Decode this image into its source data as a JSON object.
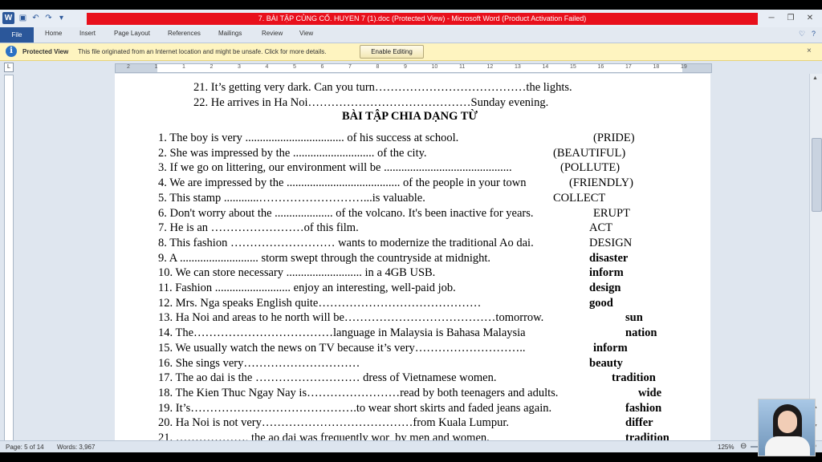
{
  "window": {
    "title": "7. BÀI TẬP CỦNG CỐ. HUYEN 7 (1).doc (Protected View)  -  Microsoft Word (Product Activation Failed)",
    "app_letter": "W"
  },
  "ribbon": {
    "tabs": [
      "File",
      "Home",
      "Insert",
      "Page Layout",
      "References",
      "Mailings",
      "Review",
      "View"
    ]
  },
  "protected_view": {
    "title": "Protected View",
    "message": "This file originated from an Internet location and might be unsafe. Click for more details.",
    "button": "Enable Editing",
    "close": "×"
  },
  "ruler": {
    "numbers": [
      "2",
      "1",
      "1",
      "2",
      "3",
      "4",
      "5",
      "6",
      "7",
      "8",
      "9",
      "10",
      "11",
      "12",
      "13",
      "14",
      "15",
      "16",
      "17",
      "18",
      "19"
    ]
  },
  "document": {
    "top_lines": [
      {
        "text": "21. It’s getting very dark. Can you turn…………………………………the lights."
      },
      {
        "text": "22. He arrives in Ha Noi……………………………………Sunday evening."
      }
    ],
    "heading": "BÀI TẬP CHIA DẠNG TỪ",
    "exercises": [
      {
        "sentence": "1. The boy is very .................................. of his success at school.",
        "word": "(PRIDE)",
        "bold": false
      },
      {
        "sentence": "2. She was impressed by the ............................ of the city.",
        "word": "(BEAUTIFUL)",
        "bold": false
      },
      {
        "sentence": "3. If we go on littering, our environment will be ............................................",
        "word": "(POLLUTE)",
        "bold": false
      },
      {
        "sentence": "4. We are impressed by the ....................................... of the people in your town",
        "word": "(FRIENDLY)",
        "bold": false
      },
      {
        "sentence": "5. This stamp ............………………………...is valuable.",
        "word": "COLLECT",
        "bold": false
      },
      {
        "sentence": "6. Don't worry about the .................... of the volcano. It's been inactive for years.",
        "word": "ERUPT",
        "bold": false
      },
      {
        "sentence": "7. He is an ……………………of this film.",
        "word": "ACT",
        "bold": false
      },
      {
        "sentence": "8. This fashion ……………………… wants to modernize the traditional Ao dai.",
        "word": "DESIGN",
        "bold": false
      },
      {
        "sentence": "9. A ........................... storm swept through the countryside at midnight.",
        "word": "disaster",
        "bold": true
      },
      {
        "sentence": "10. We can store necessary .......................... in a 4GB USB.",
        "word": "inform",
        "bold": true
      },
      {
        "sentence": "11. Fashion .......................... enjoy an interesting, well-paid job.",
        "word": "design",
        "bold": true
      },
      {
        "sentence": "12. Mrs. Nga speaks English quite……………………………………",
        "word": "good",
        "bold": true
      },
      {
        "sentence": "13. Ha Noi and areas to he north will be…………………………………tomorrow.",
        "word": "sun",
        "bold": true
      },
      {
        "sentence": "14. The………………………………language in Malaysia is Bahasa Malaysia",
        "word": "nation",
        "bold": true
      },
      {
        "sentence": "15. We usually watch the news on TV because it’s very………………………..",
        "word": "inform",
        "bold": true
      },
      {
        "sentence": "16. She sings very…………………………",
        "word": "beauty",
        "bold": true
      },
      {
        "sentence": "17. The ao dai is the ……………………… dress of Vietnamese women.",
        "word": "tradition",
        "bold": true
      },
      {
        "sentence": "18. The Kien Thuc Ngay Nay is……………………read by both teenagers and adults.",
        "word": "wide",
        "bold": true
      },
      {
        "sentence": "19. It’s…………………………………….to wear short skirts and faded jeans again.",
        "word": "fashion",
        "bold": true
      },
      {
        "sentence": "20. Ha Noi is not very…………………………………from Kuala Lumpur.",
        "word": "differ",
        "bold": true
      },
      {
        "sentence": "21. ………………, the ao dai was frequently wor  by men and women.",
        "word": "tradition",
        "bold": true
      }
    ]
  },
  "statusbar": {
    "page": "Page: 5 of 14",
    "words": "Words: 3,967",
    "zoom": "125%"
  },
  "colors": {
    "title_red": "#e8101c",
    "file_tab": "#2b579a",
    "protected_bar": "#fef4c0"
  }
}
